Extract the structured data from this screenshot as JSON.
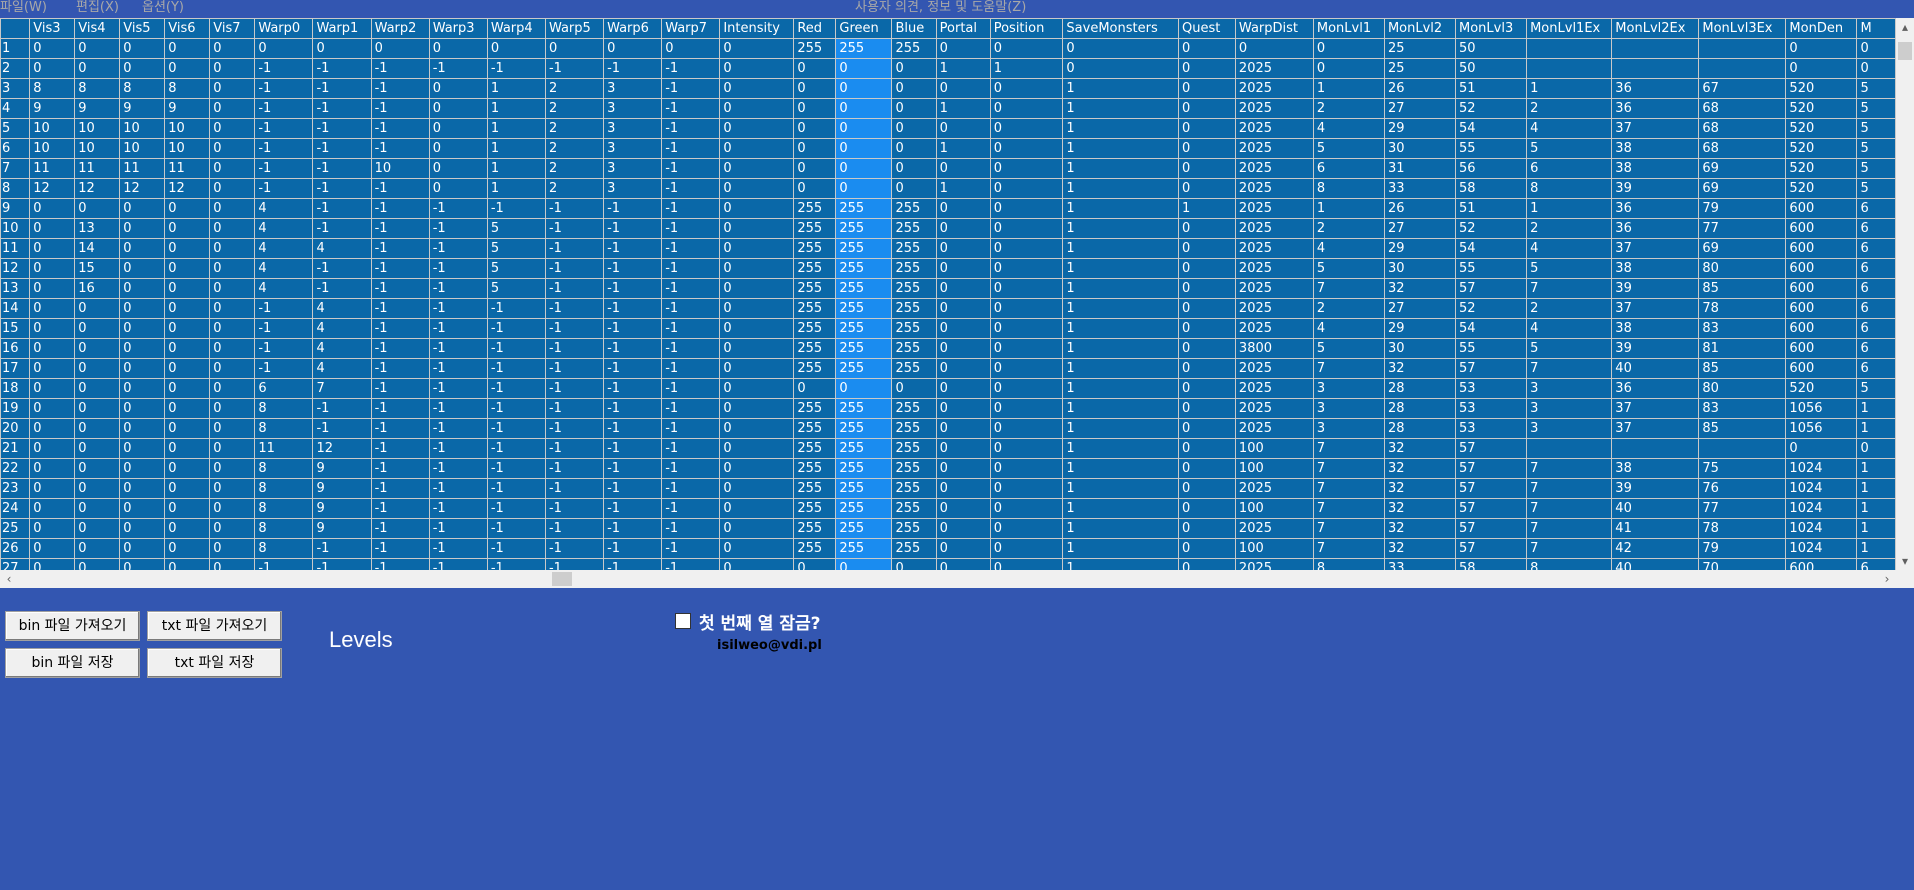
{
  "menu": {
    "items": [
      "파일(W)",
      "편집(X)",
      "옵션(Y)"
    ],
    "help": "사용자 의견, 정보 및 도움말(Z)"
  },
  "grid": {
    "columns": [
      {
        "name": "Vis3",
        "w": 46
      },
      {
        "name": "Vis4",
        "w": 46
      },
      {
        "name": "Vis5",
        "w": 46
      },
      {
        "name": "Vis6",
        "w": 46
      },
      {
        "name": "Vis7",
        "w": 46
      },
      {
        "name": "Warp0",
        "w": 59
      },
      {
        "name": "Warp1",
        "w": 59
      },
      {
        "name": "Warp2",
        "w": 59
      },
      {
        "name": "Warp3",
        "w": 59
      },
      {
        "name": "Warp4",
        "w": 59
      },
      {
        "name": "Warp5",
        "w": 59
      },
      {
        "name": "Warp6",
        "w": 59
      },
      {
        "name": "Warp7",
        "w": 59
      },
      {
        "name": "Intensity",
        "w": 75
      },
      {
        "name": "Red",
        "w": 43
      },
      {
        "name": "Green",
        "w": 57
      },
      {
        "name": "Blue",
        "w": 45
      },
      {
        "name": "Portal",
        "w": 55
      },
      {
        "name": "Position",
        "w": 74
      },
      {
        "name": "SaveMonsters",
        "w": 117
      },
      {
        "name": "Quest",
        "w": 58
      },
      {
        "name": "WarpDist",
        "w": 79
      },
      {
        "name": "MonLvl1",
        "w": 72
      },
      {
        "name": "MonLvl2",
        "w": 72
      },
      {
        "name": "MonLvl3",
        "w": 72
      },
      {
        "name": "MonLvl1Ex",
        "w": 86
      },
      {
        "name": "MonLvl2Ex",
        "w": 88
      },
      {
        "name": "MonLvl3Ex",
        "w": 88
      },
      {
        "name": "MonDen",
        "w": 72
      },
      {
        "name": "M",
        "w": 40
      }
    ],
    "selected_column": "Green",
    "rows": [
      [
        "1",
        "0",
        "0",
        "0",
        "0",
        "0",
        "0",
        "0",
        "0",
        "0",
        "0",
        "0",
        "0",
        "0",
        "0",
        "255",
        "255",
        "255",
        "0",
        "0",
        "0",
        "0",
        "0",
        "0",
        "25",
        "50",
        "",
        "",
        "",
        "0",
        "0"
      ],
      [
        "2",
        "0",
        "0",
        "0",
        "0",
        "0",
        "-1",
        "-1",
        "-1",
        "-1",
        "-1",
        "-1",
        "-1",
        "-1",
        "0",
        "0",
        "0",
        "0",
        "1",
        "1",
        "0",
        "0",
        "2025",
        "0",
        "25",
        "50",
        "",
        "",
        "",
        "0",
        "0"
      ],
      [
        "3",
        "8",
        "8",
        "8",
        "8",
        "0",
        "-1",
        "-1",
        "-1",
        "0",
        "1",
        "2",
        "3",
        "-1",
        "0",
        "0",
        "0",
        "0",
        "0",
        "0",
        "1",
        "0",
        "2025",
        "1",
        "26",
        "51",
        "1",
        "36",
        "67",
        "520",
        "5"
      ],
      [
        "4",
        "9",
        "9",
        "9",
        "9",
        "0",
        "-1",
        "-1",
        "-1",
        "0",
        "1",
        "2",
        "3",
        "-1",
        "0",
        "0",
        "0",
        "0",
        "1",
        "0",
        "1",
        "0",
        "2025",
        "2",
        "27",
        "52",
        "2",
        "36",
        "68",
        "520",
        "5"
      ],
      [
        "5",
        "10",
        "10",
        "10",
        "10",
        "0",
        "-1",
        "-1",
        "-1",
        "0",
        "1",
        "2",
        "3",
        "-1",
        "0",
        "0",
        "0",
        "0",
        "0",
        "0",
        "1",
        "0",
        "2025",
        "4",
        "29",
        "54",
        "4",
        "37",
        "68",
        "520",
        "5"
      ],
      [
        "6",
        "10",
        "10",
        "10",
        "10",
        "0",
        "-1",
        "-1",
        "-1",
        "0",
        "1",
        "2",
        "3",
        "-1",
        "0",
        "0",
        "0",
        "0",
        "1",
        "0",
        "1",
        "0",
        "2025",
        "5",
        "30",
        "55",
        "5",
        "38",
        "68",
        "520",
        "5"
      ],
      [
        "7",
        "11",
        "11",
        "11",
        "11",
        "0",
        "-1",
        "-1",
        "10",
        "0",
        "1",
        "2",
        "3",
        "-1",
        "0",
        "0",
        "0",
        "0",
        "0",
        "0",
        "1",
        "0",
        "2025",
        "6",
        "31",
        "56",
        "6",
        "38",
        "69",
        "520",
        "5"
      ],
      [
        "8",
        "12",
        "12",
        "12",
        "12",
        "0",
        "-1",
        "-1",
        "-1",
        "0",
        "1",
        "2",
        "3",
        "-1",
        "0",
        "0",
        "0",
        "0",
        "1",
        "0",
        "1",
        "0",
        "2025",
        "8",
        "33",
        "58",
        "8",
        "39",
        "69",
        "520",
        "5"
      ],
      [
        "9",
        "0",
        "0",
        "0",
        "0",
        "0",
        "4",
        "-1",
        "-1",
        "-1",
        "-1",
        "-1",
        "-1",
        "-1",
        "0",
        "255",
        "255",
        "255",
        "0",
        "0",
        "1",
        "1",
        "2025",
        "1",
        "26",
        "51",
        "1",
        "36",
        "79",
        "600",
        "6"
      ],
      [
        "10",
        "0",
        "13",
        "0",
        "0",
        "0",
        "4",
        "-1",
        "-1",
        "-1",
        "5",
        "-1",
        "-1",
        "-1",
        "0",
        "255",
        "255",
        "255",
        "0",
        "0",
        "1",
        "0",
        "2025",
        "2",
        "27",
        "52",
        "2",
        "36",
        "77",
        "600",
        "6"
      ],
      [
        "11",
        "0",
        "14",
        "0",
        "0",
        "0",
        "4",
        "4",
        "-1",
        "-1",
        "5",
        "-1",
        "-1",
        "-1",
        "0",
        "255",
        "255",
        "255",
        "0",
        "0",
        "1",
        "0",
        "2025",
        "4",
        "29",
        "54",
        "4",
        "37",
        "69",
        "600",
        "6"
      ],
      [
        "12",
        "0",
        "15",
        "0",
        "0",
        "0",
        "4",
        "-1",
        "-1",
        "-1",
        "5",
        "-1",
        "-1",
        "-1",
        "0",
        "255",
        "255",
        "255",
        "0",
        "0",
        "1",
        "0",
        "2025",
        "5",
        "30",
        "55",
        "5",
        "38",
        "80",
        "600",
        "6"
      ],
      [
        "13",
        "0",
        "16",
        "0",
        "0",
        "0",
        "4",
        "-1",
        "-1",
        "-1",
        "5",
        "-1",
        "-1",
        "-1",
        "0",
        "255",
        "255",
        "255",
        "0",
        "0",
        "1",
        "0",
        "2025",
        "7",
        "32",
        "57",
        "7",
        "39",
        "85",
        "600",
        "6"
      ],
      [
        "14",
        "0",
        "0",
        "0",
        "0",
        "0",
        "-1",
        "4",
        "-1",
        "-1",
        "-1",
        "-1",
        "-1",
        "-1",
        "0",
        "255",
        "255",
        "255",
        "0",
        "0",
        "1",
        "0",
        "2025",
        "2",
        "27",
        "52",
        "2",
        "37",
        "78",
        "600",
        "6"
      ],
      [
        "15",
        "0",
        "0",
        "0",
        "0",
        "0",
        "-1",
        "4",
        "-1",
        "-1",
        "-1",
        "-1",
        "-1",
        "-1",
        "0",
        "255",
        "255",
        "255",
        "0",
        "0",
        "1",
        "0",
        "2025",
        "4",
        "29",
        "54",
        "4",
        "38",
        "83",
        "600",
        "6"
      ],
      [
        "16",
        "0",
        "0",
        "0",
        "0",
        "0",
        "-1",
        "4",
        "-1",
        "-1",
        "-1",
        "-1",
        "-1",
        "-1",
        "0",
        "255",
        "255",
        "255",
        "0",
        "0",
        "1",
        "0",
        "3800",
        "5",
        "30",
        "55",
        "5",
        "39",
        "81",
        "600",
        "6"
      ],
      [
        "17",
        "0",
        "0",
        "0",
        "0",
        "0",
        "-1",
        "4",
        "-1",
        "-1",
        "-1",
        "-1",
        "-1",
        "-1",
        "0",
        "255",
        "255",
        "255",
        "0",
        "0",
        "1",
        "0",
        "2025",
        "7",
        "32",
        "57",
        "7",
        "40",
        "85",
        "600",
        "6"
      ],
      [
        "18",
        "0",
        "0",
        "0",
        "0",
        "0",
        "6",
        "7",
        "-1",
        "-1",
        "-1",
        "-1",
        "-1",
        "-1",
        "0",
        "0",
        "0",
        "0",
        "0",
        "0",
        "1",
        "0",
        "2025",
        "3",
        "28",
        "53",
        "3",
        "36",
        "80",
        "520",
        "5"
      ],
      [
        "19",
        "0",
        "0",
        "0",
        "0",
        "0",
        "8",
        "-1",
        "-1",
        "-1",
        "-1",
        "-1",
        "-1",
        "-1",
        "0",
        "255",
        "255",
        "255",
        "0",
        "0",
        "1",
        "0",
        "2025",
        "3",
        "28",
        "53",
        "3",
        "37",
        "83",
        "1056",
        "1"
      ],
      [
        "20",
        "0",
        "0",
        "0",
        "0",
        "0",
        "8",
        "-1",
        "-1",
        "-1",
        "-1",
        "-1",
        "-1",
        "-1",
        "0",
        "255",
        "255",
        "255",
        "0",
        "0",
        "1",
        "0",
        "2025",
        "3",
        "28",
        "53",
        "3",
        "37",
        "85",
        "1056",
        "1"
      ],
      [
        "21",
        "0",
        "0",
        "0",
        "0",
        "0",
        "11",
        "12",
        "-1",
        "-1",
        "-1",
        "-1",
        "-1",
        "-1",
        "0",
        "255",
        "255",
        "255",
        "0",
        "0",
        "1",
        "0",
        "100",
        "7",
        "32",
        "57",
        "",
        "",
        "",
        "0",
        "0"
      ],
      [
        "22",
        "0",
        "0",
        "0",
        "0",
        "0",
        "8",
        "9",
        "-1",
        "-1",
        "-1",
        "-1",
        "-1",
        "-1",
        "0",
        "255",
        "255",
        "255",
        "0",
        "0",
        "1",
        "0",
        "100",
        "7",
        "32",
        "57",
        "7",
        "38",
        "75",
        "1024",
        "1"
      ],
      [
        "23",
        "0",
        "0",
        "0",
        "0",
        "0",
        "8",
        "9",
        "-1",
        "-1",
        "-1",
        "-1",
        "-1",
        "-1",
        "0",
        "255",
        "255",
        "255",
        "0",
        "0",
        "1",
        "0",
        "2025",
        "7",
        "32",
        "57",
        "7",
        "39",
        "76",
        "1024",
        "1"
      ],
      [
        "24",
        "0",
        "0",
        "0",
        "0",
        "0",
        "8",
        "9",
        "-1",
        "-1",
        "-1",
        "-1",
        "-1",
        "-1",
        "0",
        "255",
        "255",
        "255",
        "0",
        "0",
        "1",
        "0",
        "100",
        "7",
        "32",
        "57",
        "7",
        "40",
        "77",
        "1024",
        "1"
      ],
      [
        "25",
        "0",
        "0",
        "0",
        "0",
        "0",
        "8",
        "9",
        "-1",
        "-1",
        "-1",
        "-1",
        "-1",
        "-1",
        "0",
        "255",
        "255",
        "255",
        "0",
        "0",
        "1",
        "0",
        "2025",
        "7",
        "32",
        "57",
        "7",
        "41",
        "78",
        "1024",
        "1"
      ],
      [
        "26",
        "0",
        "0",
        "0",
        "0",
        "0",
        "8",
        "-1",
        "-1",
        "-1",
        "-1",
        "-1",
        "-1",
        "-1",
        "0",
        "255",
        "255",
        "255",
        "0",
        "0",
        "1",
        "0",
        "100",
        "7",
        "32",
        "57",
        "7",
        "42",
        "79",
        "1024",
        "1"
      ],
      [
        "27",
        "0",
        "0",
        "0",
        "0",
        "0",
        "-1",
        "-1",
        "-1",
        "-1",
        "-1",
        "-1",
        "-1",
        "-1",
        "0",
        "0",
        "0",
        "0",
        "0",
        "0",
        "1",
        "0",
        "2025",
        "8",
        "33",
        "58",
        "8",
        "40",
        "70",
        "600",
        "6"
      ]
    ]
  },
  "scroll": {
    "up_icon": "chevron-up-icon",
    "down_icon": "chevron-down-icon",
    "left_icon": "chevron-left-icon",
    "right_icon": "chevron-right-icon"
  },
  "buttons": {
    "load_bin": "bin 파일 가져오기",
    "load_txt": "txt 파일 가져오기",
    "save_bin": "bin 파일 저장",
    "save_txt": "txt 파일 저장"
  },
  "title": "Levels",
  "lock_first_column": {
    "label": "첫 번째 열 잠금?",
    "checked": false
  },
  "email": "isilweo@vdi.pl",
  "colors": {
    "background": "#3356b1",
    "grid_bg": "#0a68a8",
    "selected_column": "#1a8cf0",
    "grid_line": "#c9c9c9"
  }
}
